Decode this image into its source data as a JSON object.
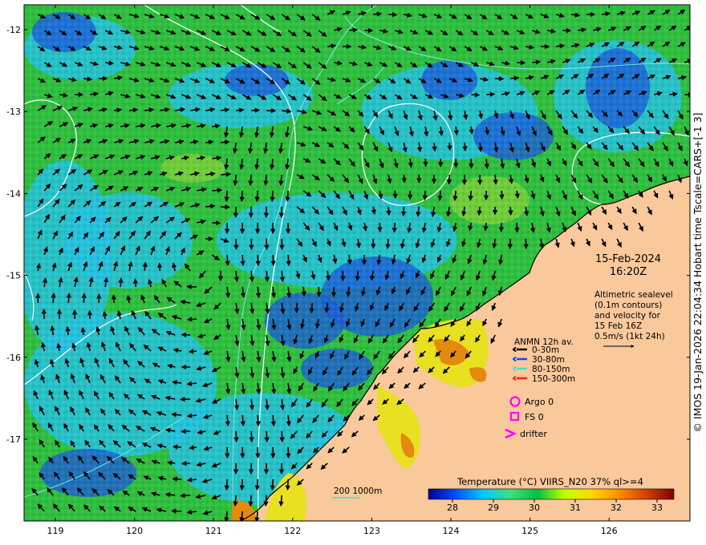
{
  "map": {
    "date": "15-Feb-2024",
    "time": "16:20Z",
    "description_lines": [
      "Altimetric sealevel",
      "(0.1m contours)",
      "and velocity for",
      "15 Feb 16Z",
      "0.5m/s (1kt 24h)"
    ],
    "x_ticks": [
      "119",
      "120",
      "121",
      "122",
      "123",
      "124",
      "125",
      "126"
    ],
    "y_ticks": [
      "-12",
      "-13",
      "-14",
      "-15",
      "-16",
      "-17"
    ],
    "credit": "© IMOS 19-Jan-2026 22:04:34 Hobart time Tscale=CARS+[-1 3]"
  },
  "legend": {
    "anmn_title": "ANMN 12h av.",
    "anmn_items": [
      {
        "label": "0-30m",
        "color": "#000000"
      },
      {
        "label": "30-80m",
        "color": "#1f3cff"
      },
      {
        "label": "80-150m",
        "color": "#40e0d0"
      },
      {
        "label": "150-300m",
        "color": "#ff2000"
      }
    ],
    "argo_label": "Argo 0",
    "fs_label": "FS 0",
    "drifter_label": "drifter",
    "marker_color": "#ff00ff",
    "depth_label": "200  1000m",
    "depth_color": "#40e0d0"
  },
  "colorbar": {
    "title": "Temperature (°C) VIIRS_N20 37% ql>=4",
    "ticks": [
      "28",
      "29",
      "30",
      "31",
      "32",
      "33"
    ],
    "palette": [
      "#00008f",
      "#0050ff",
      "#00c8ff",
      "#40e07f",
      "#00c040",
      "#c8ff00",
      "#ffd700",
      "#ff8c00",
      "#d04000",
      "#800000"
    ]
  },
  "colors": {
    "land": "#f9c89b",
    "ocean_green": "#2fbf3f",
    "ocean_cyan": "#24c2e0",
    "ocean_blue": "#1c5ed8",
    "warm_yellow": "#e8e020",
    "warm_orange": "#e48a10"
  }
}
